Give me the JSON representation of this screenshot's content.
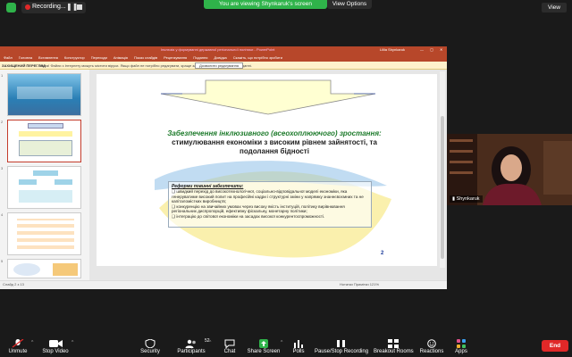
{
  "topbar": {
    "recording_label": "Recording...",
    "viewing_banner": "You are viewing Shynkaruk's screen",
    "view_options": "View Options",
    "view_button": "View"
  },
  "powerpoint": {
    "title_text": "Інклюзія у формуванні державної регіональної політики - PowerPoint",
    "user_name": "Liliia Shynkaruk",
    "ribbon_tabs": [
      "Файл",
      "Головна",
      "Вставлення",
      "Конструктор",
      "Переходи",
      "Анімація",
      "Показ слайдів",
      "Рецензування",
      "Подання",
      "Довідка",
      "Скажіть, що потрібно зробити"
    ],
    "protected_label": "ЗАХИЩЕНИЙ ПЕРЕГЛЯД",
    "protected_message": "Увага! Файли з Інтернету можуть містити віруси. Якщо файл не потрібно редагувати, краще залишатися в Захищеному поданні.",
    "protected_button": "Дозволити редагування",
    "thumb_numbers": [
      "1",
      "2",
      "3",
      "4",
      "5"
    ],
    "status_left": "Слайд 2 з 13",
    "status_right": "Нотатки   Примітки   121%"
  },
  "slide": {
    "title_highlight": "Забезпечення інклюзивного (всеохоплюючого) зростання:",
    "title_rest": "стимулювання економіки з високим рівнем зайнятості, та подолання бідності",
    "box_title": "Реформи повинні забезпечити:",
    "box_items": [
      "❑ швидкий перехід до високотехнологічної, соціально-відповідальної моделі економіки, яка генеруватиме високий попит на професійні кадри і структурні зміни у напрямку знаннєвоємних та не капіталомістких виробництв;",
      "❑ конкуренцію на звичайних умовах через високу якість інституцій, політику вирівнювання регіональних диспропорцій, ефективну фіскальну, монетарну політики;",
      "❑ інтеграцію до світової економіки на засадах високої конкурентоспроможності."
    ],
    "page_number": "2"
  },
  "video": {
    "participant_name": "Shynkaruk"
  },
  "toolbar": {
    "unmute": "Unmute",
    "stop_video": "Stop Video",
    "security": "Security",
    "participants": "Participants",
    "participants_count": "52",
    "chat": "Chat",
    "share_screen": "Share Screen",
    "polls": "Polls",
    "record": "Pause/Stop Recording",
    "breakout": "Breakout Rooms",
    "reactions": "Reactions",
    "apps": "Apps",
    "end": "End"
  },
  "colors": {
    "zoom_green": "#2fb34a",
    "ppt_red": "#b7472a",
    "end_red": "#e02828",
    "slide_title_green": "#1c7a2a"
  }
}
